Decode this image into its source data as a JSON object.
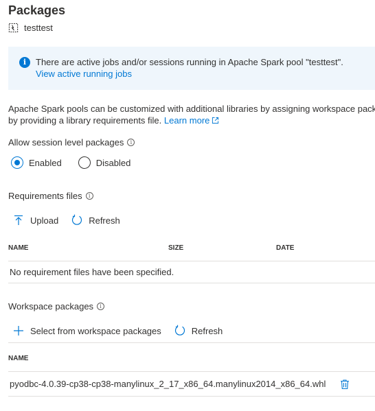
{
  "page": {
    "title": "Packages",
    "pool_name": "testtest"
  },
  "banner": {
    "message": "There are active jobs and/or sessions running in Apache Spark pool \"testtest\".",
    "link": "View active running jobs"
  },
  "description": {
    "line1": "Apache Spark pools can be customized with additional libraries by assigning workspace packages",
    "line2": "by providing a library requirements file.",
    "learn_more": "Learn more"
  },
  "session_packages": {
    "label": "Allow session level packages",
    "options": [
      {
        "label": "Enabled",
        "selected": true
      },
      {
        "label": "Disabled",
        "selected": false
      }
    ]
  },
  "requirements": {
    "label": "Requirements files",
    "upload": "Upload",
    "refresh": "Refresh",
    "columns": [
      "NAME",
      "SIZE",
      "DATE"
    ],
    "empty_message": "No requirement files have been specified."
  },
  "workspace_packages": {
    "label": "Workspace packages",
    "select": "Select from workspace packages",
    "refresh": "Refresh",
    "columns": [
      "NAME"
    ],
    "rows": [
      "pyodbc-4.0.39-cp38-cp38-manylinux_2_17_x86_64.manylinux2014_x86_64.whl"
    ]
  },
  "colors": {
    "accent": "#0078d4",
    "banner_bg": "#eff6fc",
    "text": "#323130",
    "divider": "#e1dfdd"
  }
}
